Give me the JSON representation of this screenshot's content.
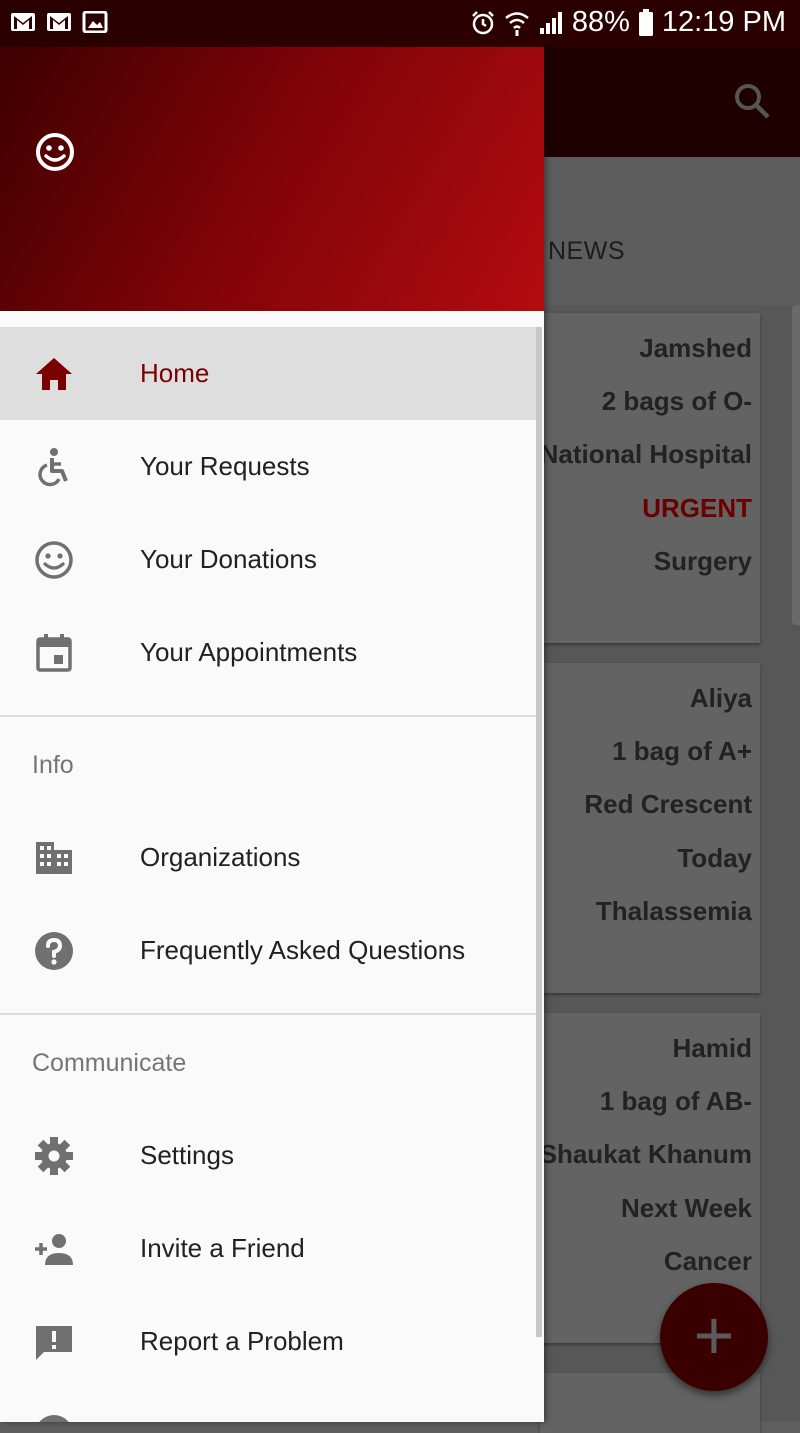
{
  "status_bar": {
    "battery": "88%",
    "time": "12:19 PM"
  },
  "background_app": {
    "tab": "NEWS",
    "cards": [
      {
        "lines": [
          "Jamshed",
          "2 bags of O-",
          "National Hospital",
          "URGENT",
          "Surgery"
        ]
      },
      {
        "lines": [
          "Aliya",
          "1 bag of A+",
          "Red Crescent",
          "Today",
          "Thalassemia"
        ]
      },
      {
        "lines": [
          "Hamid",
          "1 bag of AB-",
          "Shaukat Khanum",
          "Next Week",
          "Cancer"
        ]
      }
    ],
    "fab_label": "+"
  },
  "drawer": {
    "items_main": [
      {
        "label": "Home",
        "icon": "home-icon"
      },
      {
        "label": "Your Requests",
        "icon": "accessible-icon"
      },
      {
        "label": "Your Donations",
        "icon": "smiley-icon"
      },
      {
        "label": "Your Appointments",
        "icon": "calendar-icon"
      }
    ],
    "info": {
      "title": "Info",
      "items": [
        {
          "label": "Organizations",
          "icon": "building-icon"
        },
        {
          "label": "Frequently Asked Questions",
          "icon": "help-icon"
        }
      ]
    },
    "communicate": {
      "title": "Communicate",
      "items": [
        {
          "label": "Settings",
          "icon": "gear-icon"
        },
        {
          "label": "Invite a Friend",
          "icon": "person-add-icon"
        },
        {
          "label": "Report a Problem",
          "icon": "feedback-icon"
        }
      ]
    }
  },
  "colors": {
    "brand": "#7a0000",
    "header_dark": "#3d0000",
    "header_light": "#b30c0f"
  }
}
